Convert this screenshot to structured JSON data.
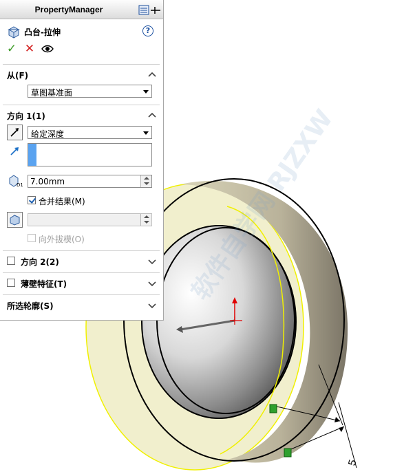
{
  "property_manager": {
    "title": "PropertyManager",
    "feature_title": "凸台-拉伸",
    "help_label": "?",
    "actions": {
      "ok": "✓",
      "cancel": "✕",
      "preview": "eye-icon"
    },
    "from_section": {
      "title": "从(F)",
      "start_condition": "草图基准面"
    },
    "direction1": {
      "title": "方向 1(1)",
      "end_condition": "给定深度",
      "depth": "7.00mm",
      "merge_result_label": "合并结果(M)",
      "merge_result_checked": true,
      "draft_outward_label": "向外拔模(O)",
      "draft_outward_checked": false
    },
    "direction2": {
      "title": "方向 2(2)",
      "checked": false
    },
    "thin_feature": {
      "title": "薄壁特征(T)",
      "checked": false
    },
    "selected_contours": {
      "title": "所选轮廓(S)"
    }
  },
  "viewport": {
    "dimension_value": "5",
    "watermark_text": "软件自学网 RJZXW"
  },
  "colors": {
    "part_face": "#e9e7c6",
    "part_outline": "#f2f200",
    "edge": "#000000",
    "accent_blue": "#5aa3f0",
    "ok_green": "#3d9c27",
    "cancel_red": "#d42424"
  }
}
